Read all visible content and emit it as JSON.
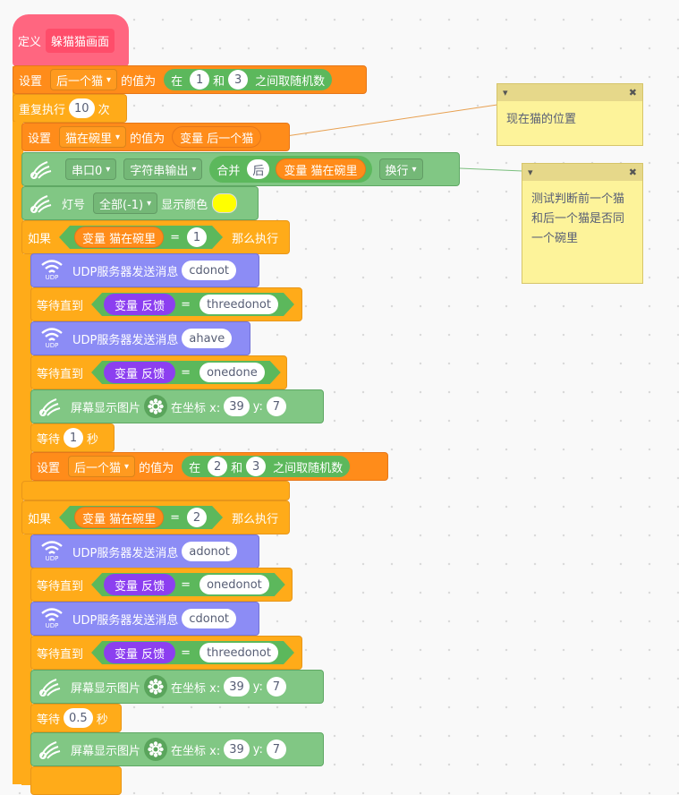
{
  "define": {
    "label": "定义",
    "name": "躲猫猫画面"
  },
  "set1": {
    "label": "设置",
    "var": "后一个猫",
    "of": "的值为",
    "pre": "在",
    "a": "1",
    "and": "和",
    "b": "3",
    "post": "之间取随机数"
  },
  "repeat": {
    "label": "重复执行",
    "count": "10",
    "unit": "次"
  },
  "set2": {
    "label": "设置",
    "var": "猫在碗里",
    "of": "的值为",
    "rep": "变量 后一个猫"
  },
  "serial": {
    "port": "串口0",
    "mode": "字符串输出",
    "join": "合并",
    "joinA": "后",
    "joinB": "变量 猫在碗里",
    "newline": "换行"
  },
  "led": {
    "label": "灯号",
    "which": "全部(-1)",
    "color_label": "显示颜色",
    "color": "#ffff00"
  },
  "if1": {
    "label": "如果",
    "var": "变量 猫在碗里",
    "eq": "=",
    "val": "1",
    "then": "那么执行"
  },
  "udp_label": "UDP服务器发送消息",
  "udp_sub": "UDP",
  "waituntil_label": "等待直到",
  "feedback": "变量 反馈",
  "eq": "=",
  "if1_body": {
    "udp1": "cdonot",
    "wait1": "threedonot",
    "udp2": "ahave",
    "wait2": "onedone",
    "screen": {
      "label": "屏幕显示图片",
      "at": "在坐标 x:",
      "x": "39",
      "ylabel": "y:",
      "y": "7"
    },
    "wait": {
      "label": "等待",
      "sec": "1",
      "unit": "秒"
    },
    "set": {
      "label": "设置",
      "var": "后一个猫",
      "of": "的值为",
      "pre": "在",
      "a": "2",
      "and": "和",
      "b": "3",
      "post": "之间取随机数"
    }
  },
  "if2": {
    "label": "如果",
    "var": "变量 猫在碗里",
    "eq": "=",
    "val": "2",
    "then": "那么执行"
  },
  "if2_body": {
    "udp1": "adonot",
    "wait1": "onedonot",
    "udp2": "cdonot",
    "wait2": "threedonot",
    "screen1": {
      "label": "屏幕显示图片",
      "at": "在坐标 x:",
      "x": "39",
      "ylabel": "y:",
      "y": "7"
    },
    "wait": {
      "label": "等待",
      "sec": "0.5",
      "unit": "秒"
    },
    "screen2": {
      "label": "屏幕显示图片",
      "at": "在坐标 x:",
      "x": "39",
      "ylabel": "y:",
      "y": "7"
    }
  },
  "notes": [
    {
      "text": "现在猫的位置"
    },
    {
      "text": "测试判断前一个猫和后一个猫是否同一个碗里"
    }
  ],
  "icons": {
    "collapse": "▾",
    "close": "✖"
  }
}
